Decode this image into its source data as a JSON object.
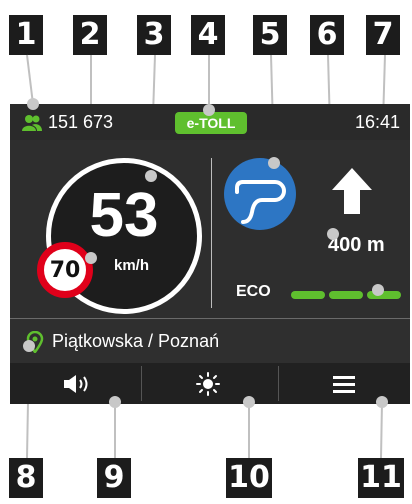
{
  "callouts": [
    "1",
    "2",
    "3",
    "4",
    "5",
    "6",
    "7",
    "8",
    "9",
    "10",
    "11"
  ],
  "status_bar": {
    "user_count": "151 673",
    "etoll_label": "e-TOLL",
    "time": "16:41"
  },
  "speedometer": {
    "speed": "53",
    "unit": "km/h"
  },
  "speed_limit": "70",
  "navigation": {
    "maneuver_icon": "road-curve-icon",
    "next_direction_icon": "arrow-up-icon",
    "distance": "400 m"
  },
  "eco": {
    "label": "ECO",
    "level": 3,
    "max": 3
  },
  "location": {
    "text": "Piątkowska / Poznań"
  },
  "bottom_bar": [
    {
      "name": "sound-button",
      "icon": "speaker-icon"
    },
    {
      "name": "brightness-button",
      "icon": "sun-icon"
    },
    {
      "name": "menu-button",
      "icon": "menu-icon"
    }
  ],
  "colors": {
    "accent_green": "#5fbf2e",
    "maneuver_blue": "#2d76c4",
    "limit_red": "#e0001a",
    "panel_dark": "#2f2f2f"
  }
}
